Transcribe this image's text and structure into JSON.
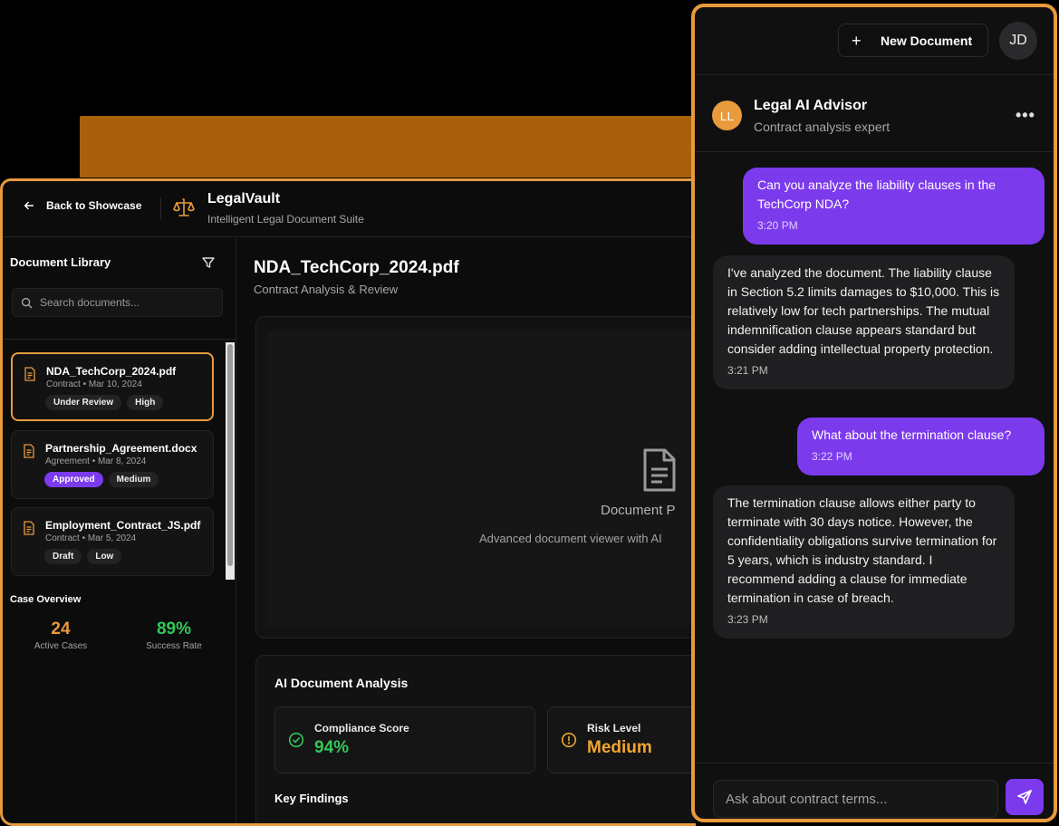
{
  "app": {
    "back_label": "Back to Showcase",
    "brand_title": "LegalVault",
    "brand_subtitle": "Intelligent Legal Document Suite"
  },
  "sidebar": {
    "title": "Document Library",
    "search_placeholder": "Search documents...",
    "documents": [
      {
        "name": "NDA_TechCorp_2024.pdf",
        "meta": "Contract • Mar 10, 2024",
        "status": "Under Review",
        "priority": "High"
      },
      {
        "name": "Partnership_Agreement.docx",
        "meta": "Agreement • Mar 8, 2024",
        "status": "Approved",
        "priority": "Medium"
      },
      {
        "name": "Employment_Contract_JS.pdf",
        "meta": "Contract • Mar 5, 2024",
        "status": "Draft",
        "priority": "Low"
      }
    ],
    "case_overview": {
      "title": "Case Overview",
      "active_cases": "24",
      "active_cases_label": "Active Cases",
      "success_rate": "89%",
      "success_rate_label": "Success Rate"
    }
  },
  "content": {
    "doc_title": "NDA_TechCorp_2024.pdf",
    "doc_subtitle": "Contract Analysis & Review",
    "viewer_title": "Document P",
    "viewer_subtitle": "Advanced document viewer with AI",
    "analysis": {
      "title": "AI Document Analysis",
      "compliance_label": "Compliance Score",
      "compliance_value": "94%",
      "risk_label": "Risk Level",
      "risk_value": "Medium",
      "key_findings": "Key Findings"
    }
  },
  "chat": {
    "new_document": "New Document",
    "user_initials": "JD",
    "advisor_initials": "LL",
    "advisor_name": "Legal AI Advisor",
    "advisor_role": "Contract analysis expert",
    "menu": "•••",
    "messages": [
      {
        "text": "Can you analyze the liability clauses in the TechCorp NDA?",
        "time": "3:20 PM"
      },
      {
        "text": "I've analyzed the document. The liability clause in Section 5.2 limits damages to $10,000. This is relatively low for tech partnerships. The mutual indemnification clause appears standard but consider adding intellectual property protection.",
        "time": "3:21 PM"
      },
      {
        "text": "What about the termination clause?",
        "time": "3:22 PM"
      },
      {
        "text": "The termination clause allows either party to terminate with 30 days notice. However, the confidentiality obligations survive termination for 5 years, which is industry standard. I recommend adding a clause for immediate termination in case of breach.",
        "time": "3:23 PM"
      }
    ],
    "input_placeholder": "Ask about contract terms..."
  },
  "colors": {
    "accent_orange": "#e89a3c",
    "accent_purple": "#7c3aed",
    "success_green": "#34c759",
    "warning_amber": "#f0a630"
  }
}
